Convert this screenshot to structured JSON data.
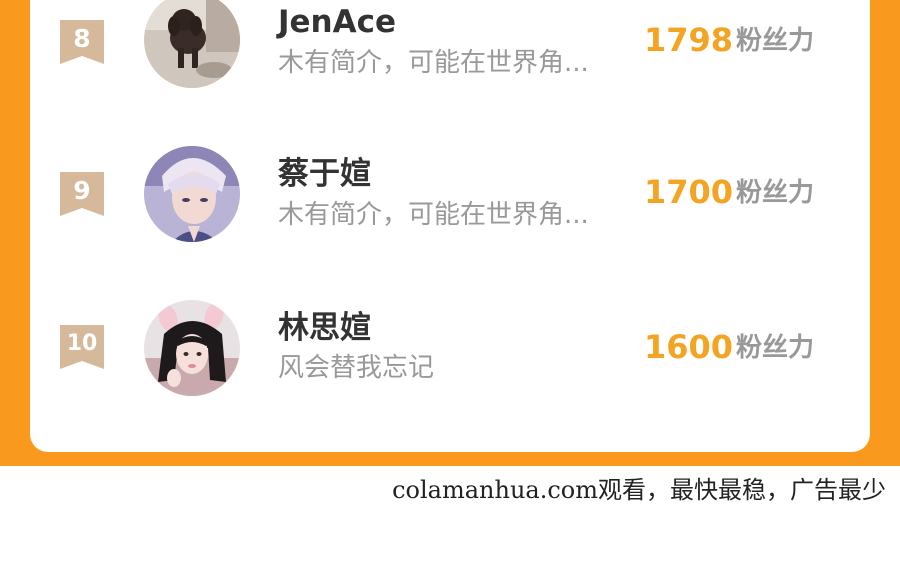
{
  "ranking": [
    {
      "rank": "8",
      "name": "JenAce",
      "bio": "木有简介，可能在世界角...",
      "fans_value": "1798",
      "fans_unit": "粉丝力",
      "avatar_icon": "poodle-dog-photo"
    },
    {
      "rank": "9",
      "name": "蔡于媗",
      "bio": "木有简介，可能在世界角...",
      "fans_value": "1700",
      "fans_unit": "粉丝力",
      "avatar_icon": "anime-boy-illustration"
    },
    {
      "rank": "10",
      "name": "林思媗",
      "bio": "风会替我忘记",
      "fans_value": "1600",
      "fans_unit": "粉丝力",
      "avatar_icon": "girl-with-bunny-ears-photo"
    }
  ],
  "colors": {
    "panel_background": "#f99a1f",
    "card_background": "#ffffff",
    "badge": "#d6b89a",
    "fans_value": "#f4a423",
    "muted_text": "#999999",
    "name_text": "#333333"
  },
  "footer": {
    "watermark": "colamanhua.com观看，最快最稳，广告最少"
  }
}
